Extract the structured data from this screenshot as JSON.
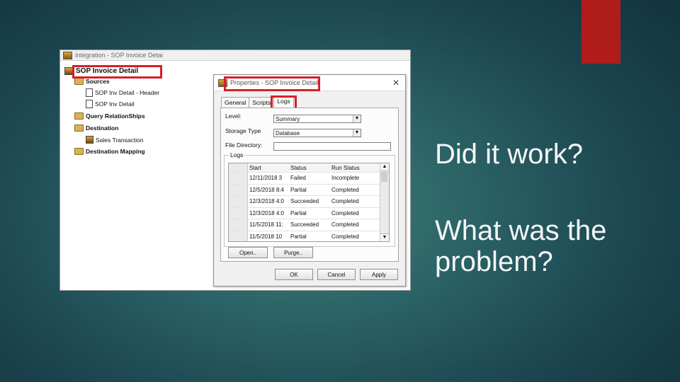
{
  "slide": {
    "question1": "Did it work?",
    "question2": "What was the problem?",
    "colors": {
      "accent": "#b01c19",
      "highlight": "#d5202a"
    }
  },
  "app": {
    "window_title": "Integration - SOP Invoice Detai",
    "tree": {
      "root": "SOP Invoice Detail",
      "sources": "Sources",
      "source_header": "SOP Inv Detail - Header",
      "source_detail": "SOP Inv Detail",
      "query_relationships": "Query RelationShips",
      "destination": "Destination",
      "sales_transaction": "Sales Transaction",
      "destination_mapping": "Destination Mapping"
    }
  },
  "dialog": {
    "title": "Properties - SOP Invoice Detail",
    "close_glyph": "✕",
    "tabs": [
      {
        "label": "General"
      },
      {
        "label": "Scripts"
      },
      {
        "label": "Logs",
        "active": true
      }
    ],
    "level_label": "Level:",
    "level_value": "Summary",
    "storage_label": "Storage Type",
    "storage_value": "Database",
    "file_dir_label": "File Directory:",
    "file_dir_value": "",
    "logs_caption": "Logs",
    "grid_headers": {
      "start": "Start",
      "status": "Status",
      "run_status": "Run Status"
    },
    "rows": [
      {
        "start": "12/11/2018 3",
        "status": "Failed",
        "run_status": "Incomplete"
      },
      {
        "start": "12/5/2018 8:4",
        "status": "Partial",
        "run_status": "Completed"
      },
      {
        "start": "12/3/2018 4:0",
        "status": "Succeeded",
        "run_status": "Completed"
      },
      {
        "start": "12/3/2018 4:0",
        "status": "Partial",
        "run_status": "Completed"
      },
      {
        "start": "11/5/2018 11:",
        "status": "Succeeded",
        "run_status": "Completed"
      },
      {
        "start": "11/5/2018 10",
        "status": "Partial",
        "run_status": "Completed"
      }
    ],
    "open_button": "Open..",
    "purge_button": "Purge..",
    "ok_button": "OK",
    "cancel_button": "Cancel",
    "apply_button": "Apply"
  }
}
